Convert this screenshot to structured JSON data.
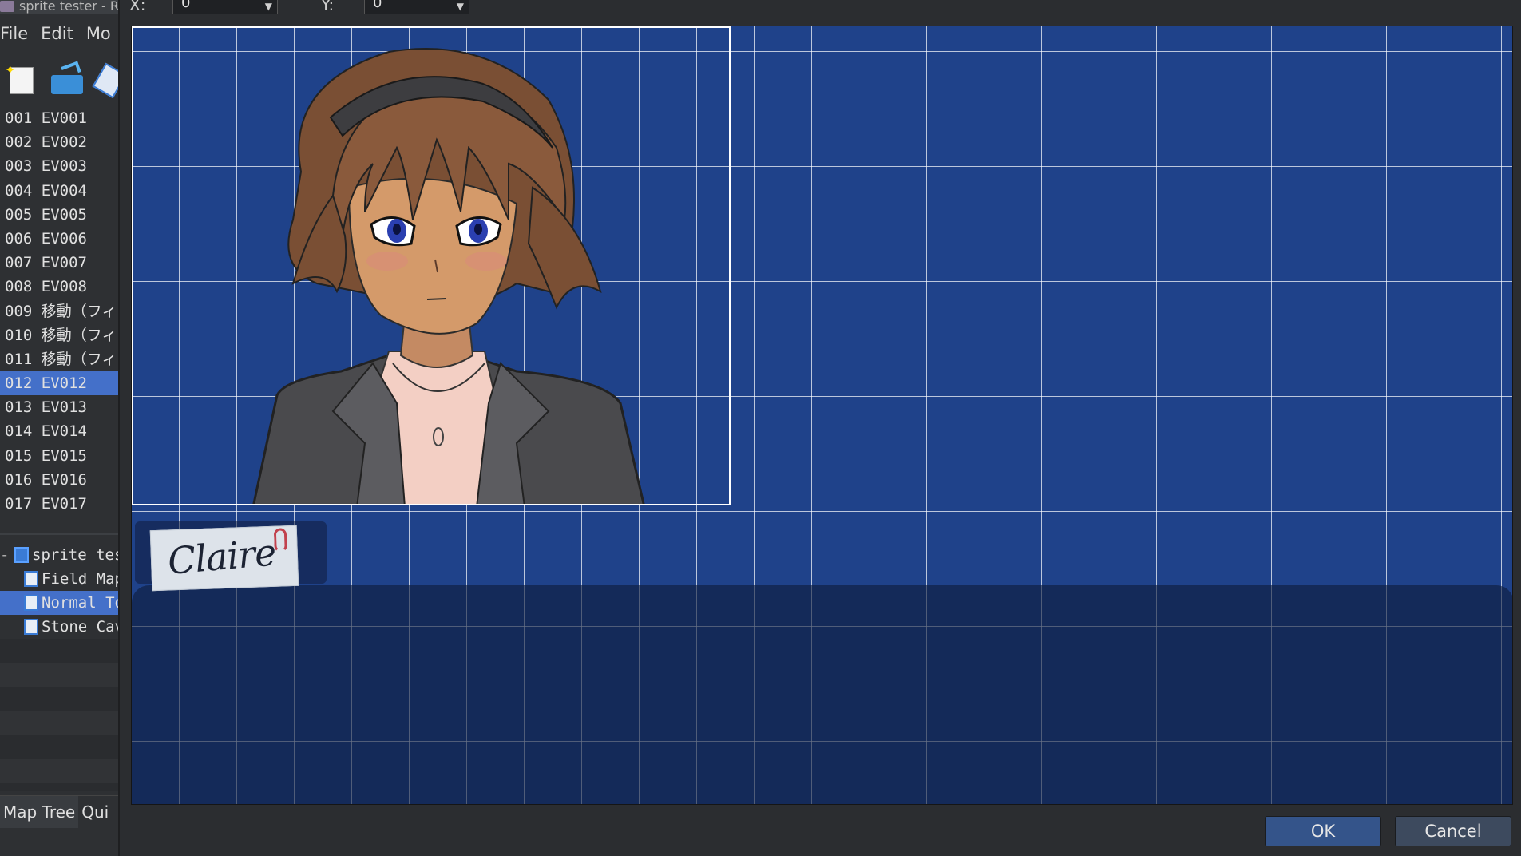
{
  "window": {
    "title": "sprite tester - R"
  },
  "menu": {
    "file": "File",
    "edit": "Edit",
    "mode": "Mo"
  },
  "events": [
    {
      "label": "001 EV001"
    },
    {
      "label": "002 EV002"
    },
    {
      "label": "003 EV003"
    },
    {
      "label": "004 EV004"
    },
    {
      "label": "005 EV005"
    },
    {
      "label": "006 EV006"
    },
    {
      "label": "007 EV007"
    },
    {
      "label": "008 EV008"
    },
    {
      "label": "009 移動（フィ"
    },
    {
      "label": "010 移動（フィ"
    },
    {
      "label": "011 移動（フィ"
    },
    {
      "label": "012 EV012",
      "selected": true
    },
    {
      "label": "013 EV013"
    },
    {
      "label": "014 EV014"
    },
    {
      "label": "015 EV015"
    },
    {
      "label": "016 EV016"
    },
    {
      "label": "017 EV017"
    }
  ],
  "map_tree": {
    "root": "sprite tes",
    "items": [
      {
        "label": "Field Map"
      },
      {
        "label": "Normal To",
        "selected": true
      },
      {
        "label": "Stone Cav"
      }
    ]
  },
  "bottom_tabs": {
    "map_tree": "Map Tree",
    "quick": "Qui"
  },
  "dialog": {
    "x_label": "X:",
    "x_value": "0",
    "y_label": "Y:",
    "y_value": "0",
    "speaker_name": "Claire",
    "ok": "OK",
    "cancel": "Cancel"
  },
  "colors": {
    "grid_background": "#1f428a",
    "selection": "#4470c9",
    "ok_button": "#34548a"
  }
}
